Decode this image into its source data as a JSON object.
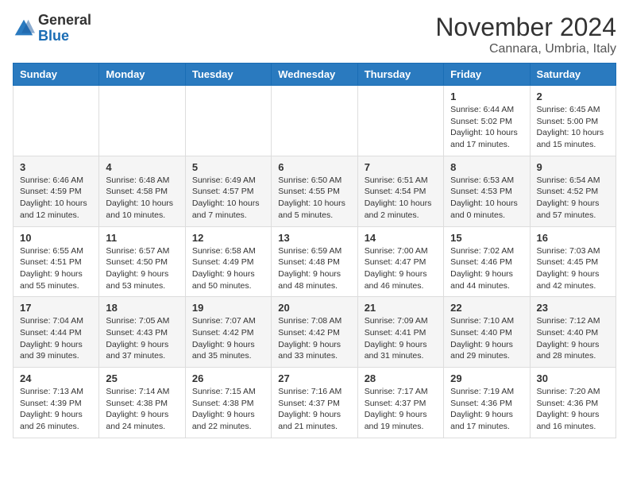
{
  "logo": {
    "general": "General",
    "blue": "Blue"
  },
  "header": {
    "month_title": "November 2024",
    "subtitle": "Cannara, Umbria, Italy"
  },
  "days_of_week": [
    "Sunday",
    "Monday",
    "Tuesday",
    "Wednesday",
    "Thursday",
    "Friday",
    "Saturday"
  ],
  "weeks": [
    [
      {
        "day": "",
        "info": ""
      },
      {
        "day": "",
        "info": ""
      },
      {
        "day": "",
        "info": ""
      },
      {
        "day": "",
        "info": ""
      },
      {
        "day": "",
        "info": ""
      },
      {
        "day": "1",
        "info": "Sunrise: 6:44 AM\nSunset: 5:02 PM\nDaylight: 10 hours and 17 minutes."
      },
      {
        "day": "2",
        "info": "Sunrise: 6:45 AM\nSunset: 5:00 PM\nDaylight: 10 hours and 15 minutes."
      }
    ],
    [
      {
        "day": "3",
        "info": "Sunrise: 6:46 AM\nSunset: 4:59 PM\nDaylight: 10 hours and 12 minutes."
      },
      {
        "day": "4",
        "info": "Sunrise: 6:48 AM\nSunset: 4:58 PM\nDaylight: 10 hours and 10 minutes."
      },
      {
        "day": "5",
        "info": "Sunrise: 6:49 AM\nSunset: 4:57 PM\nDaylight: 10 hours and 7 minutes."
      },
      {
        "day": "6",
        "info": "Sunrise: 6:50 AM\nSunset: 4:55 PM\nDaylight: 10 hours and 5 minutes."
      },
      {
        "day": "7",
        "info": "Sunrise: 6:51 AM\nSunset: 4:54 PM\nDaylight: 10 hours and 2 minutes."
      },
      {
        "day": "8",
        "info": "Sunrise: 6:53 AM\nSunset: 4:53 PM\nDaylight: 10 hours and 0 minutes."
      },
      {
        "day": "9",
        "info": "Sunrise: 6:54 AM\nSunset: 4:52 PM\nDaylight: 9 hours and 57 minutes."
      }
    ],
    [
      {
        "day": "10",
        "info": "Sunrise: 6:55 AM\nSunset: 4:51 PM\nDaylight: 9 hours and 55 minutes."
      },
      {
        "day": "11",
        "info": "Sunrise: 6:57 AM\nSunset: 4:50 PM\nDaylight: 9 hours and 53 minutes."
      },
      {
        "day": "12",
        "info": "Sunrise: 6:58 AM\nSunset: 4:49 PM\nDaylight: 9 hours and 50 minutes."
      },
      {
        "day": "13",
        "info": "Sunrise: 6:59 AM\nSunset: 4:48 PM\nDaylight: 9 hours and 48 minutes."
      },
      {
        "day": "14",
        "info": "Sunrise: 7:00 AM\nSunset: 4:47 PM\nDaylight: 9 hours and 46 minutes."
      },
      {
        "day": "15",
        "info": "Sunrise: 7:02 AM\nSunset: 4:46 PM\nDaylight: 9 hours and 44 minutes."
      },
      {
        "day": "16",
        "info": "Sunrise: 7:03 AM\nSunset: 4:45 PM\nDaylight: 9 hours and 42 minutes."
      }
    ],
    [
      {
        "day": "17",
        "info": "Sunrise: 7:04 AM\nSunset: 4:44 PM\nDaylight: 9 hours and 39 minutes."
      },
      {
        "day": "18",
        "info": "Sunrise: 7:05 AM\nSunset: 4:43 PM\nDaylight: 9 hours and 37 minutes."
      },
      {
        "day": "19",
        "info": "Sunrise: 7:07 AM\nSunset: 4:42 PM\nDaylight: 9 hours and 35 minutes."
      },
      {
        "day": "20",
        "info": "Sunrise: 7:08 AM\nSunset: 4:42 PM\nDaylight: 9 hours and 33 minutes."
      },
      {
        "day": "21",
        "info": "Sunrise: 7:09 AM\nSunset: 4:41 PM\nDaylight: 9 hours and 31 minutes."
      },
      {
        "day": "22",
        "info": "Sunrise: 7:10 AM\nSunset: 4:40 PM\nDaylight: 9 hours and 29 minutes."
      },
      {
        "day": "23",
        "info": "Sunrise: 7:12 AM\nSunset: 4:40 PM\nDaylight: 9 hours and 28 minutes."
      }
    ],
    [
      {
        "day": "24",
        "info": "Sunrise: 7:13 AM\nSunset: 4:39 PM\nDaylight: 9 hours and 26 minutes."
      },
      {
        "day": "25",
        "info": "Sunrise: 7:14 AM\nSunset: 4:38 PM\nDaylight: 9 hours and 24 minutes."
      },
      {
        "day": "26",
        "info": "Sunrise: 7:15 AM\nSunset: 4:38 PM\nDaylight: 9 hours and 22 minutes."
      },
      {
        "day": "27",
        "info": "Sunrise: 7:16 AM\nSunset: 4:37 PM\nDaylight: 9 hours and 21 minutes."
      },
      {
        "day": "28",
        "info": "Sunrise: 7:17 AM\nSunset: 4:37 PM\nDaylight: 9 hours and 19 minutes."
      },
      {
        "day": "29",
        "info": "Sunrise: 7:19 AM\nSunset: 4:36 PM\nDaylight: 9 hours and 17 minutes."
      },
      {
        "day": "30",
        "info": "Sunrise: 7:20 AM\nSunset: 4:36 PM\nDaylight: 9 hours and 16 minutes."
      }
    ]
  ]
}
